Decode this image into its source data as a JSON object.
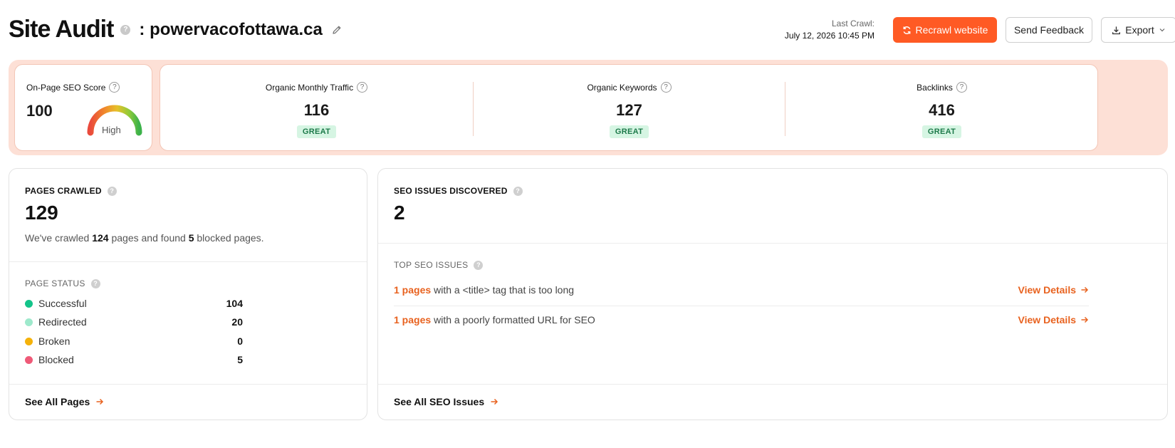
{
  "header": {
    "title": "Site Audit",
    "help_glyph": "?",
    "domain": ": powervacofottawa.ca",
    "last_crawl_label": "Last Crawl:",
    "last_crawl_value": "July 12, 2026 10:45 PM",
    "recrawl_label": "Recrawl website",
    "feedback_label": "Send Feedback",
    "export_label": "Export"
  },
  "score": {
    "label": "On-Page SEO Score",
    "value": "100",
    "level": "High",
    "gauge_fraction": 1.0
  },
  "metrics": [
    {
      "label": "Organic Monthly Traffic",
      "value": "116",
      "badge": "GREAT"
    },
    {
      "label": "Organic Keywords",
      "value": "127",
      "badge": "GREAT"
    },
    {
      "label": "Backlinks",
      "value": "416",
      "badge": "GREAT"
    }
  ],
  "pages": {
    "title": "PAGES CRAWLED",
    "total": "129",
    "desc_prefix": "We've crawled ",
    "desc_crawled": "124",
    "desc_middle": " pages and found ",
    "desc_blocked": "5",
    "desc_suffix": " blocked pages.",
    "status_title": "PAGE STATUS",
    "status": [
      {
        "label": "Successful",
        "count": "104",
        "color": "#14c48a"
      },
      {
        "label": "Redirected",
        "count": "20",
        "color": "#9ee9cc"
      },
      {
        "label": "Broken",
        "count": "0",
        "color": "#f5b20a"
      },
      {
        "label": "Blocked",
        "count": "5",
        "color": "#ef5a78"
      }
    ],
    "footer_link": "See All Pages"
  },
  "issues": {
    "title": "SEO ISSUES DISCOVERED",
    "total": "2",
    "top_title": "TOP SEO ISSUES",
    "items": [
      {
        "count": "1 pages",
        "text": "with a <title> tag that is too long",
        "action": "View Details"
      },
      {
        "count": "1 pages",
        "text": "with a poorly formatted URL for SEO",
        "action": "View Details"
      }
    ],
    "footer_link": "See All SEO Issues"
  },
  "colors": {
    "accent": "#ff5a24",
    "link_orange": "#e8621f",
    "strip_bg": "#fde0d6",
    "badge_bg": "#d6f5e3",
    "badge_text": "#1d7a4a"
  },
  "icons": [
    "help-icon",
    "pencil-icon",
    "refresh-icon",
    "download-icon",
    "chevron-down-icon",
    "arrow-right-icon",
    "gauge-icon"
  ]
}
